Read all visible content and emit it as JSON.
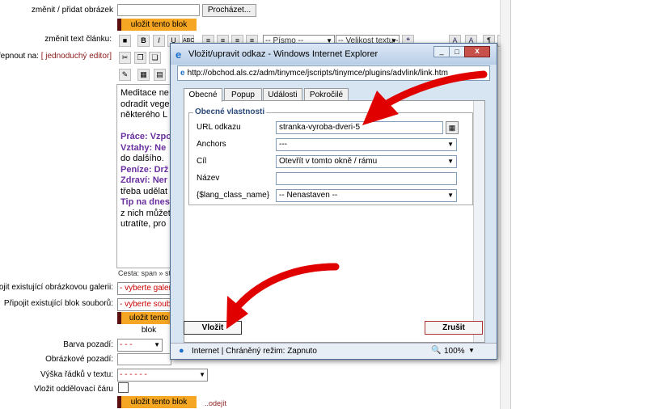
{
  "form": {
    "change_image_label": "změnit / přidat obrázek",
    "browse_button": "Procházet...",
    "save_block_button": "uložit tento blok",
    "change_text_label": "změnit text článku:",
    "switch_label": "přepnout na:",
    "switch_link": "[ jednoduchý editor]",
    "font_select": "-- Písmo --",
    "size_select": "-- Velikost textu --",
    "attach_gallery_label": "Připojit existující obrázkovou galerii:",
    "gallery_select": "- vyberte galerii -",
    "attach_files_label": "Připojit existující blok souborů:",
    "files_select": "- vyberte soubor",
    "bg_color_label": "Barva pozadí:",
    "bg_color_select": "- - -",
    "bg_image_label": "Obrázkové pozadí:",
    "line_height_label": "Výška řádků v textu:",
    "line_height_select": "- - - - - -",
    "divider_label": "Vložit oddělovací čáru",
    "remove_link": "..odejít",
    "path_label": "Cesta: span » stro"
  },
  "editor_text": [
    {
      "t": "Meditace ne",
      "c": "#000"
    },
    {
      "t": "odradit vege",
      "c": "#000"
    },
    {
      "t": "některého L",
      "c": "#000"
    },
    {
      "t": "",
      "c": "#000"
    },
    {
      "t": "Práce: Vzpo",
      "c": "#6a2fa0"
    },
    {
      "t": "Vztahy: Ne",
      "c": "#6a2fa0"
    },
    {
      "t": "do dalšího.",
      "c": "#000"
    },
    {
      "t": "Peníze: Drž",
      "c": "#6a2fa0"
    },
    {
      "t": "Zdraví: Ner",
      "c": "#6a2fa0"
    },
    {
      "t": "třeba udělat",
      "c": "#000"
    },
    {
      "t": "Tip na dnes",
      "c": "#6a2fa0"
    },
    {
      "t": "z nich můžet",
      "c": "#000"
    },
    {
      "t": "utratíte, pro",
      "c": "#000"
    }
  ],
  "dialog": {
    "title": "Vložit/upravit odkaz - Windows Internet Explorer",
    "address": "http://obchod.als.cz/adm/tinymce/jscripts/tinymce/plugins/advlink/link.htm",
    "tabs": [
      "Obecné",
      "Popup",
      "Události",
      "Pokročilé"
    ],
    "legend": "Obecné vlastnosti",
    "url_label": "URL odkazu",
    "url_value": "stranka-vyroba-dveri-5",
    "anchors_label": "Anchors",
    "anchors_value": "---",
    "target_label": "Cíl",
    "target_value": "Otevřít v tomto okně / rámu",
    "title_label": "Název",
    "title_value": "",
    "class_label": "{$lang_class_name}",
    "class_value": "-- Nenastaven --",
    "insert_button": "Vložit",
    "cancel_button": "Zrušit",
    "status": "Internet | Chráněný režim: Zapnuto",
    "zoom": "100%"
  },
  "colors": {
    "accent_orange": "#f5a623",
    "arrow_red": "#e00000",
    "dialog_bg": "#d7e4f2"
  }
}
